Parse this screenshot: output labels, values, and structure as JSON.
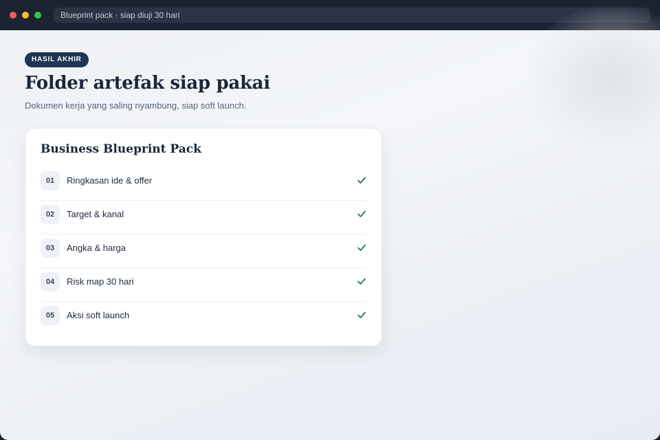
{
  "window": {
    "address": "Blueprint pack · siap diuji 30 hari"
  },
  "header": {
    "badge": "HASIL AKHIR",
    "title": "Folder artefak siap pakai",
    "subtitle": "Dokumen kerja yang saling nyambung, siap soft launch."
  },
  "card": {
    "title": "Business Blueprint Pack",
    "items": [
      {
        "num": "01",
        "label": "Ringkasan ide & offer",
        "done": true
      },
      {
        "num": "02",
        "label": "Target & kanal",
        "done": true
      },
      {
        "num": "03",
        "label": "Angka & harga",
        "done": true
      },
      {
        "num": "04",
        "label": "Risk map 30 hari",
        "done": true
      },
      {
        "num": "05",
        "label": "Aksi soft launch",
        "done": true
      }
    ]
  },
  "colors": {
    "badge_bg": "#1f3556",
    "check": "#1f7a4d",
    "title": "#1a2638"
  }
}
